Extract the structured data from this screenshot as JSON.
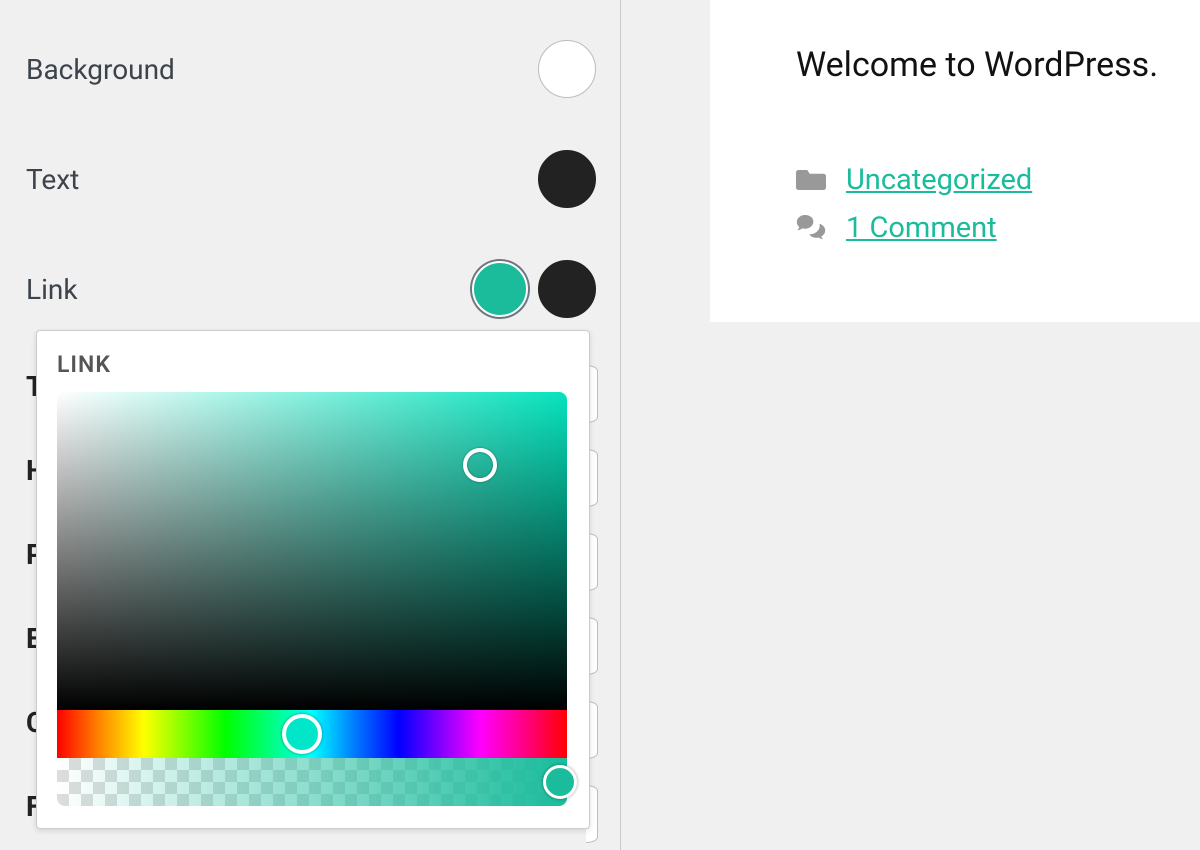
{
  "sidebar": {
    "items": [
      {
        "label": "Background"
      },
      {
        "label": "Text"
      },
      {
        "label": "Link"
      }
    ],
    "hidden_labels": [
      "T",
      "H",
      "P",
      "E",
      "C",
      "F"
    ]
  },
  "colors": {
    "background": "#ffffff",
    "text": "#222222",
    "link_default": "#1abc9c",
    "link_hover": "#222222"
  },
  "picker": {
    "title": "LINK",
    "hue_base": "#06e3bd",
    "selected": "#1abc9c"
  },
  "preview": {
    "welcome": "Welcome to WordPress.",
    "category_link": "Uncategorized",
    "comments_link": "1 Comment"
  }
}
